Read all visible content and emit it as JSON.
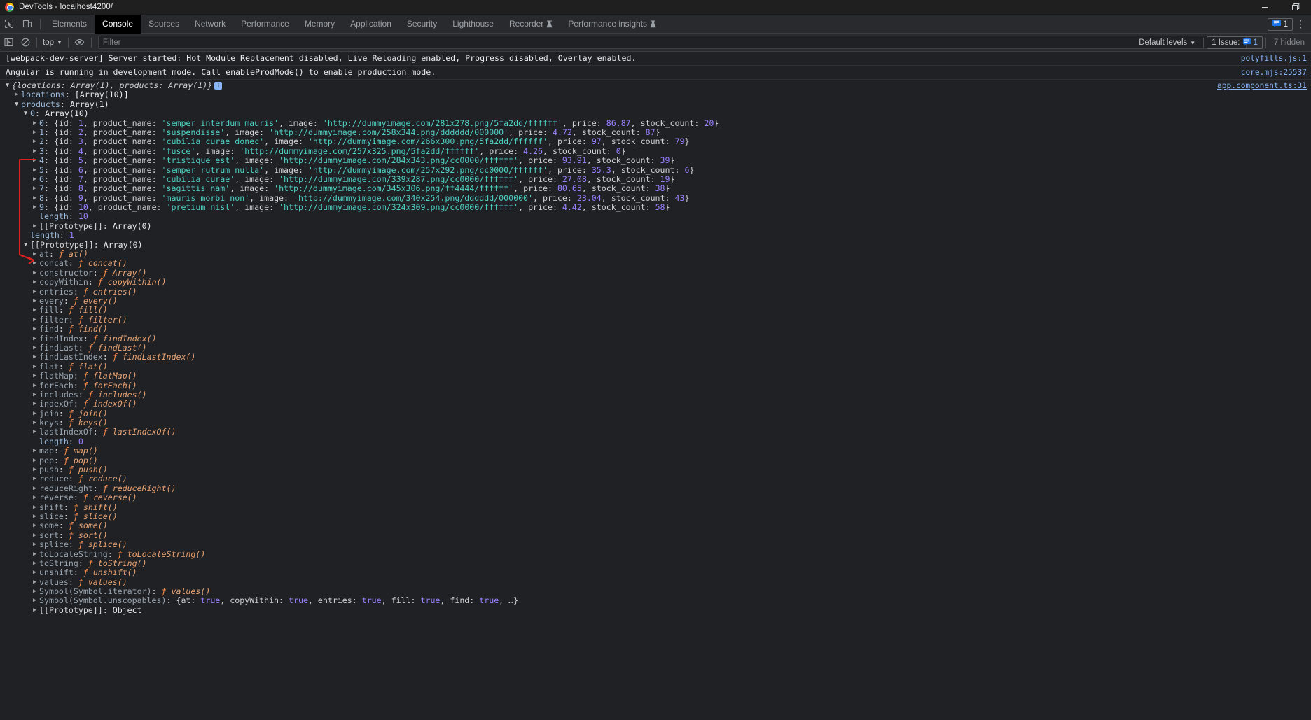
{
  "window": {
    "title": "DevTools - localhost4200/",
    "minimize_label": "Minimize",
    "restore_label": "Restore"
  },
  "tabs": [
    {
      "label": "Elements",
      "active": false,
      "flask": false
    },
    {
      "label": "Console",
      "active": true,
      "flask": false
    },
    {
      "label": "Sources",
      "active": false,
      "flask": false
    },
    {
      "label": "Network",
      "active": false,
      "flask": false
    },
    {
      "label": "Performance",
      "active": false,
      "flask": false
    },
    {
      "label": "Memory",
      "active": false,
      "flask": false
    },
    {
      "label": "Application",
      "active": false,
      "flask": false
    },
    {
      "label": "Security",
      "active": false,
      "flask": false
    },
    {
      "label": "Lighthouse",
      "active": false,
      "flask": false
    },
    {
      "label": "Recorder",
      "active": false,
      "flask": true
    },
    {
      "label": "Performance insights",
      "active": false,
      "flask": true
    }
  ],
  "tabbar": {
    "inspect_icon": "inspect-element-icon",
    "device_icon": "device-toolbar-icon",
    "issue_count": "1",
    "more_label": "⋮"
  },
  "console_toolbar": {
    "clear_icon": "clear-console-icon",
    "no_entry_icon": "no-entry-icon",
    "context": "top",
    "eye_icon": "live-expression-icon",
    "filter_placeholder": "Filter",
    "levels": "Default levels",
    "issues_label": "1 Issue:",
    "issues_count": "1",
    "hidden_label": "7 hidden"
  },
  "messages": [
    {
      "text": "[webpack-dev-server] Server started: Hot Module Replacement disabled, Live Reloading enabled, Progress disabled, Overlay enabled.",
      "source": "polyfills.js:1"
    },
    {
      "text": "Angular is running in development mode. Call enableProdMode() to enable production mode.",
      "source": "core.mjs:25537"
    }
  ],
  "object_source": "app.component.ts:31",
  "object_root": "{locations: Array(1), products: Array(1)}",
  "locations_line": "locations: [Array(10)]",
  "products_label": "products:",
  "products_value": "Array(1)",
  "array0_label": "0:",
  "array0_value": "Array(10)",
  "products": [
    {
      "index": "0",
      "id": "1",
      "product_name": "semper interdum mauris",
      "image": "http://dummyimage.com/281x278.png/5fa2dd/ffffff",
      "price": "86.87",
      "stock_count": "20"
    },
    {
      "index": "1",
      "id": "2",
      "product_name": "suspendisse",
      "image": "http://dummyimage.com/258x344.png/dddddd/000000",
      "price": "4.72",
      "stock_count": "87"
    },
    {
      "index": "2",
      "id": "3",
      "product_name": "cubilia curae donec",
      "image": "http://dummyimage.com/266x300.png/5fa2dd/ffffff",
      "price": "97",
      "stock_count": "79"
    },
    {
      "index": "3",
      "id": "4",
      "product_name": "fusce",
      "image": "http://dummyimage.com/257x325.png/5fa2dd/ffffff",
      "price": "4.26",
      "stock_count": "0"
    },
    {
      "index": "4",
      "id": "5",
      "product_name": "tristique est",
      "image": "http://dummyimage.com/284x343.png/cc0000/ffffff",
      "price": "93.91",
      "stock_count": "39"
    },
    {
      "index": "5",
      "id": "6",
      "product_name": "semper rutrum nulla",
      "image": "http://dummyimage.com/257x292.png/cc0000/ffffff",
      "price": "35.3",
      "stock_count": "6"
    },
    {
      "index": "6",
      "id": "7",
      "product_name": "cubilia curae",
      "image": "http://dummyimage.com/339x287.png/cc0000/ffffff",
      "price": "27.08",
      "stock_count": "19"
    },
    {
      "index": "7",
      "id": "8",
      "product_name": "sagittis nam",
      "image": "http://dummyimage.com/345x306.png/ff4444/ffffff",
      "price": "80.65",
      "stock_count": "38"
    },
    {
      "index": "8",
      "id": "9",
      "product_name": "mauris morbi non",
      "image": "http://dummyimage.com/340x254.png/dddddd/000000",
      "price": "23.04",
      "stock_count": "43"
    },
    {
      "index": "9",
      "id": "10",
      "product_name": "pretium nisl",
      "image": "http://dummyimage.com/324x309.png/cc0000/ffffff",
      "price": "4.42",
      "stock_count": "58"
    }
  ],
  "inner_length_label": "length:",
  "inner_length_value": "10",
  "inner_proto_label": "[[Prototype]]:",
  "inner_proto_value": "Array(0)",
  "outer_length_label": "length:",
  "outer_length_value": "1",
  "proto_label": "[[Prototype]]:",
  "proto_value": "Array(0)",
  "proto_members": [
    {
      "key": "at",
      "value": "at()"
    },
    {
      "key": "concat",
      "value": "concat()"
    },
    {
      "key": "constructor",
      "value": "Array()"
    },
    {
      "key": "copyWithin",
      "value": "copyWithin()"
    },
    {
      "key": "entries",
      "value": "entries()"
    },
    {
      "key": "every",
      "value": "every()"
    },
    {
      "key": "fill",
      "value": "fill()"
    },
    {
      "key": "filter",
      "value": "filter()"
    },
    {
      "key": "find",
      "value": "find()"
    },
    {
      "key": "findIndex",
      "value": "findIndex()"
    },
    {
      "key": "findLast",
      "value": "findLast()"
    },
    {
      "key": "findLastIndex",
      "value": "findLastIndex()"
    },
    {
      "key": "flat",
      "value": "flat()"
    },
    {
      "key": "flatMap",
      "value": "flatMap()"
    },
    {
      "key": "forEach",
      "value": "forEach()"
    },
    {
      "key": "includes",
      "value": "includes()"
    },
    {
      "key": "indexOf",
      "value": "indexOf()"
    },
    {
      "key": "join",
      "value": "join()"
    },
    {
      "key": "keys",
      "value": "keys()"
    },
    {
      "key": "lastIndexOf",
      "value": "lastIndexOf()"
    }
  ],
  "proto_length_label": "length:",
  "proto_length_value": "0",
  "proto_members2": [
    {
      "key": "map",
      "value": "map()"
    },
    {
      "key": "pop",
      "value": "pop()"
    },
    {
      "key": "push",
      "value": "push()"
    },
    {
      "key": "reduce",
      "value": "reduce()"
    },
    {
      "key": "reduceRight",
      "value": "reduceRight()"
    },
    {
      "key": "reverse",
      "value": "reverse()"
    },
    {
      "key": "shift",
      "value": "shift()"
    },
    {
      "key": "slice",
      "value": "slice()"
    },
    {
      "key": "some",
      "value": "some()"
    },
    {
      "key": "sort",
      "value": "sort()"
    },
    {
      "key": "splice",
      "value": "splice()"
    },
    {
      "key": "toLocaleString",
      "value": "toLocaleString()"
    },
    {
      "key": "toString",
      "value": "toString()"
    },
    {
      "key": "unshift",
      "value": "unshift()"
    },
    {
      "key": "values",
      "value": "values()"
    }
  ],
  "symbol_iterator": {
    "key": "Symbol(Symbol.iterator):",
    "value": "values()"
  },
  "symbol_unscopables": {
    "key": "Symbol(Symbol.unscopables):",
    "entries": [
      {
        "name": "at",
        "value": "true"
      },
      {
        "name": "copyWithin",
        "value": "true"
      },
      {
        "name": "entries",
        "value": "true"
      },
      {
        "name": "fill",
        "value": "true"
      },
      {
        "name": "find",
        "value": "true"
      }
    ],
    "ellipsis": "…"
  },
  "final_proto": {
    "label": "[[Prototype]]:",
    "value": "Object"
  },
  "annotation": {
    "name": "red-bracket-annotation",
    "color": "#e02020"
  }
}
